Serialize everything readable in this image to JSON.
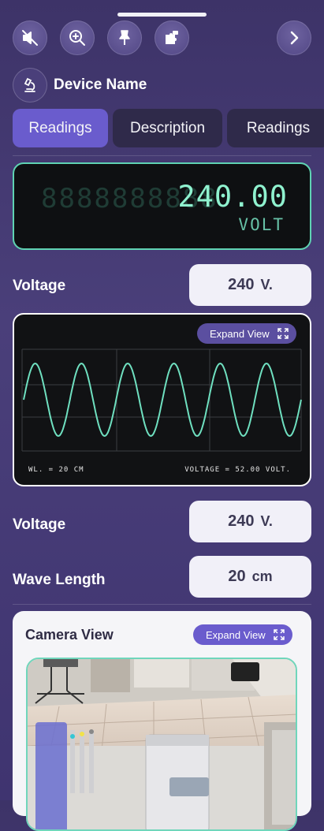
{
  "toolbar": {
    "buttons": [
      {
        "icon": "mute-icon"
      },
      {
        "icon": "zoom-in-icon"
      },
      {
        "icon": "pin-icon"
      },
      {
        "icon": "puzzle-icon"
      }
    ],
    "next_icon": "chevron-right-icon"
  },
  "device": {
    "name": "Device Name",
    "icon": "microscope-icon"
  },
  "tabs": [
    {
      "label": "Readings",
      "active": true
    },
    {
      "label": "Description",
      "active": false
    },
    {
      "label": "Readings",
      "active": false
    }
  ],
  "display": {
    "ghost_digits": "8888888888",
    "reading": "240.00",
    "unit": "VOLT"
  },
  "voltage_row_1": {
    "label": "Voltage",
    "value": "240",
    "unit": "V."
  },
  "oscilloscope": {
    "expand_label": "Expand View",
    "wavelength_text": "WL. = 20 CM",
    "voltage_text": "VOLTAGE = 52.00 VOLT."
  },
  "voltage_row_2": {
    "label": "Voltage",
    "value": "240",
    "unit": "V."
  },
  "wavelength_row": {
    "label": "Wave Length",
    "value": "20",
    "unit": "cm"
  },
  "camera": {
    "title": "Camera View",
    "expand_label": "Expand View"
  },
  "colors": {
    "accent": "#6a5ccd",
    "lcd_green": "#8ff2cf",
    "wave": "#6fe0c0"
  }
}
